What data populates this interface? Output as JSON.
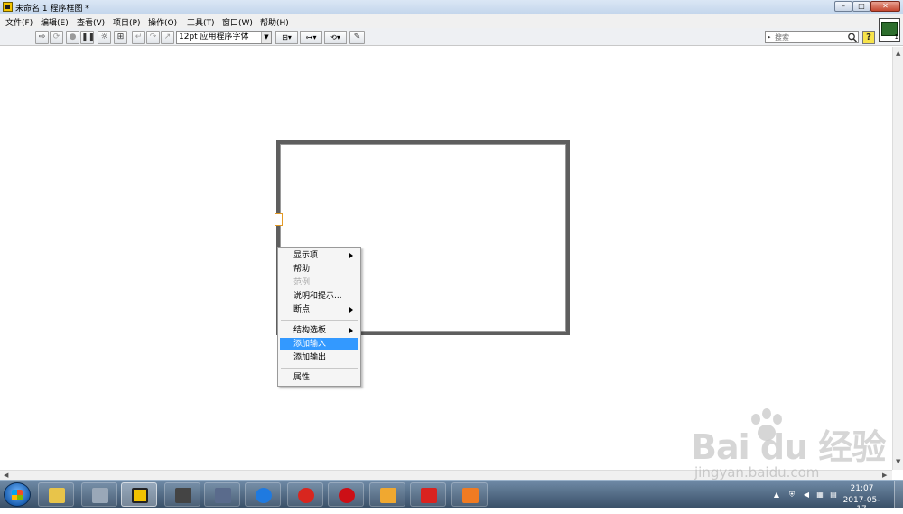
{
  "window": {
    "title": "未命名 1 程序框图 *",
    "minimize_glyph": "–",
    "maximize_glyph": "□",
    "close_glyph": "✕"
  },
  "menu": [
    {
      "label": "文件(F)"
    },
    {
      "label": "编辑(E)"
    },
    {
      "label": "查看(V)"
    },
    {
      "label": "项目(P)"
    },
    {
      "label": "操作(O)"
    },
    {
      "label": "工具(T)"
    },
    {
      "label": "窗口(W)"
    },
    {
      "label": "帮助(H)"
    }
  ],
  "toolbar": {
    "font_select_value": "12pt 应用程序字体",
    "search_placeholder": "搜索",
    "help_glyph": "?",
    "vi_icon_number": "1"
  },
  "context_menu": {
    "items": [
      {
        "label": "显示项",
        "submenu": true,
        "disabled": false,
        "selected": false
      },
      {
        "label": "帮助",
        "submenu": false,
        "disabled": false,
        "selected": false
      },
      {
        "label": "范例",
        "submenu": false,
        "disabled": true,
        "selected": false
      },
      {
        "label": "说明和提示...",
        "submenu": false,
        "disabled": false,
        "selected": false
      },
      {
        "label": "断点",
        "submenu": true,
        "disabled": false,
        "selected": false
      },
      {
        "label": "结构选板",
        "submenu": true,
        "disabled": false,
        "selected": false
      },
      {
        "label": "添加输入",
        "submenu": false,
        "disabled": false,
        "selected": true
      },
      {
        "label": "添加输出",
        "submenu": false,
        "disabled": false,
        "selected": false
      },
      {
        "label": "属性",
        "submenu": false,
        "disabled": false,
        "selected": false
      }
    ]
  },
  "watermark": {
    "brand": "Bai du 经验",
    "url": "jingyan.baidu.com"
  },
  "taskbar": {
    "clock_time": "21:07",
    "clock_date": "2017-05-17",
    "apps": [
      {
        "name": "file-explorer",
        "color": "#e8c44a"
      },
      {
        "name": "calculator",
        "color": "#9aa8b8"
      },
      {
        "name": "labview",
        "color": "#f2c200"
      },
      {
        "name": "chip-tool",
        "color": "#444444"
      },
      {
        "name": "serial-port",
        "color": "#5a6b8c"
      },
      {
        "name": "teamviewer",
        "color": "#1f7ae0"
      },
      {
        "name": "red-app",
        "color": "#d8261f"
      },
      {
        "name": "opera",
        "color": "#cc0f16"
      },
      {
        "name": "package-app",
        "color": "#f0a830"
      },
      {
        "name": "print-app",
        "color": "#d9231f"
      },
      {
        "name": "presentation-app",
        "color": "#f07b22"
      }
    ]
  }
}
